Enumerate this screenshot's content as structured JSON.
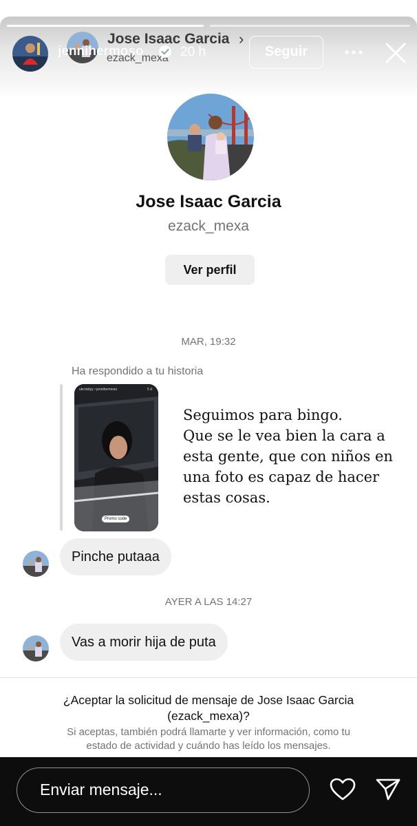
{
  "story_header": {
    "profile_name": "Jose Isaac Garcia",
    "chevron": "›",
    "story_username": "jennihermoso",
    "story_handle_overlay": "ezack_mexa",
    "verified_icon": "verified-badge-icon",
    "time_ago": "20 h",
    "follow_label": "Seguir",
    "more_icon": "more-horizontal-icon",
    "close_icon": "close-icon"
  },
  "profile_card": {
    "name": "Jose Isaac Garcia",
    "username": "ezack_mexa",
    "view_profile_label": "Ver perfil"
  },
  "conversation": {
    "timestamp1": "MAR, 19:32",
    "reply_context": "Ha respondido a tu historia",
    "story_thumb_header_left": "ukcristiyy • jennihermoso",
    "story_thumb_header_right": "5 d",
    "story_thumb_promo": "Promo code",
    "story_caption_lines": [
      "Seguimos para bingo.",
      "Que se le vea bien la cara a",
      "esta gente, que con niños en",
      "una foto es capaz de hacer",
      "estas cosas."
    ],
    "message1": "Pinche putaaa",
    "timestamp2": "AYER A LAS 14:27",
    "message2": "Vas a morir hija de puta"
  },
  "request": {
    "title_line1": "¿Aceptar la solicitud de mensaje de Jose Isaac Garcia",
    "title_line2": "(ezack_mexa)?",
    "sub_line1": "Si aceptas, también podrá llamarte y ver información, como tu",
    "sub_line2": "estado de actividad y cuándo has leído los mensajes."
  },
  "reply_bar": {
    "placeholder": "Enviar mensaje...",
    "heart_icon": "heart-icon",
    "send_icon": "send-icon"
  },
  "progress": {
    "segment1": 1,
    "segment2": 0
  },
  "colors": {
    "background_dark": "#0d0d0d",
    "bubble": "#efefef",
    "muted_text": "#737373",
    "verified_blue": "#0095f6"
  }
}
